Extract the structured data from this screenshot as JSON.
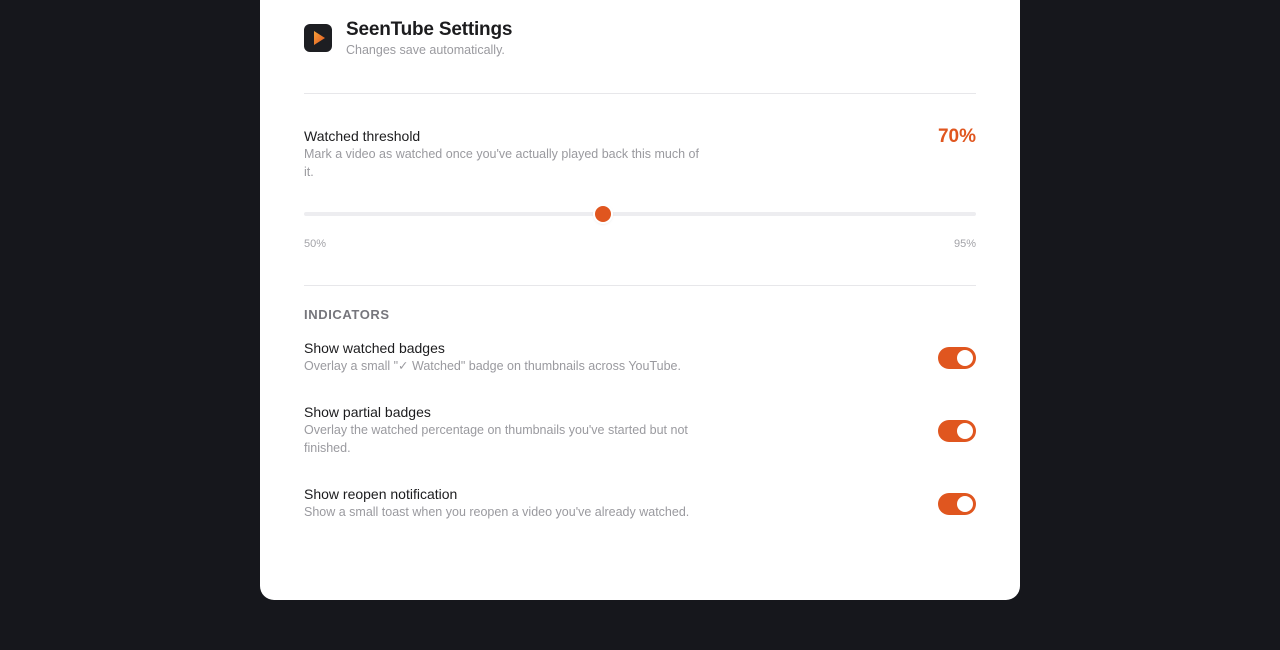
{
  "app": {
    "title": "SeenTube Settings",
    "subtitle": "Changes save automatically.",
    "logo_icon": "play-icon"
  },
  "threshold": {
    "label": "Watched threshold",
    "description": "Mark a video as watched once you've actually played back this much of it.",
    "value_display": "70%",
    "value": 70,
    "min": 50,
    "max": 95,
    "min_label": "50%",
    "max_label": "95%"
  },
  "indicators": {
    "heading": "INDICATORS",
    "items": [
      {
        "label": "Show watched badges",
        "description": "Overlay a small \"✓ Watched\" badge on thumbnails across YouTube.",
        "enabled": true
      },
      {
        "label": "Show partial badges",
        "description": "Overlay the watched percentage on thumbnails you've started but not finished.",
        "enabled": true
      },
      {
        "label": "Show reopen notification",
        "description": "Show a small toast when you reopen a video you've already watched.",
        "enabled": true
      }
    ]
  },
  "colors": {
    "accent": "#e0561f",
    "backdrop": "#16171c",
    "panel": "#ffffff"
  }
}
